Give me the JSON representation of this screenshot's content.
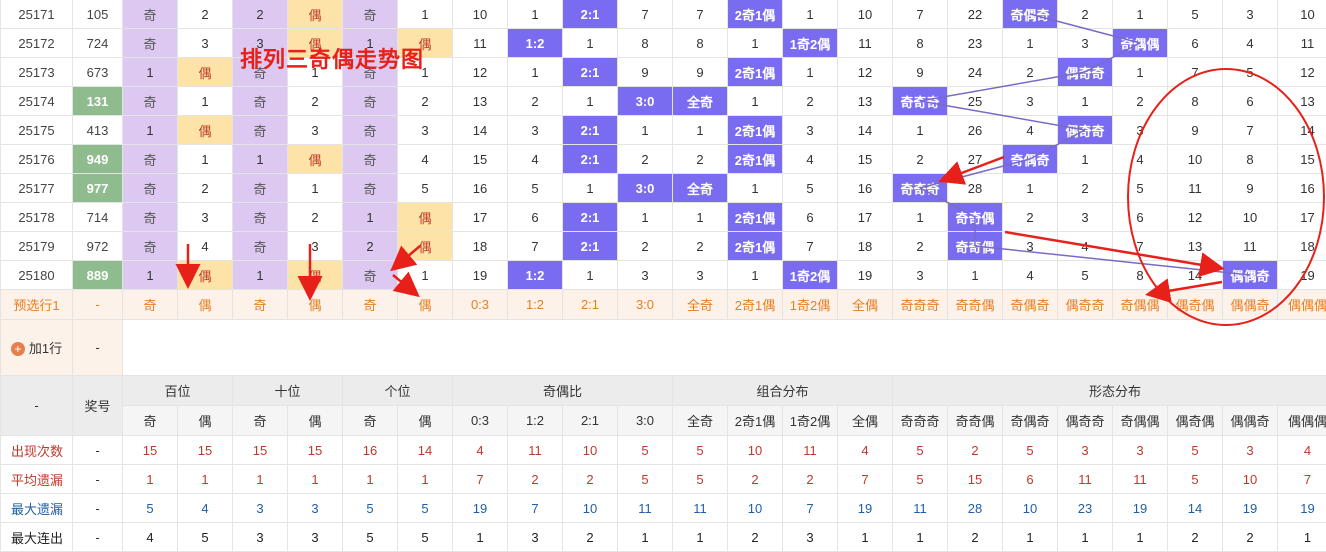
{
  "overlay_title": "排列三奇偶走势图",
  "rows": [
    {
      "issue": "25171",
      "num": "105",
      "big": false,
      "bai": [
        "奇",
        "2"
      ],
      "shi": [
        "2",
        "偶"
      ],
      "ge": [
        "奇",
        "1"
      ],
      "ratio": [
        "10",
        "1",
        "2:1",
        "7"
      ],
      "combo": [
        "7",
        "2奇1偶",
        "1",
        "10"
      ],
      "shape": [
        "7",
        "22",
        "奇偶奇",
        "2",
        "1",
        "5",
        "3",
        "10"
      ]
    },
    {
      "issue": "25172",
      "num": "724",
      "big": false,
      "bai": [
        "奇",
        "3"
      ],
      "shi": [
        "3",
        "偶"
      ],
      "ge": [
        "1",
        "偶"
      ],
      "ratio": [
        "11",
        "1:2",
        "1",
        "8"
      ],
      "combo": [
        "8",
        "1",
        "1奇2偶",
        "11"
      ],
      "shape": [
        "8",
        "23",
        "1",
        "3",
        "奇偶偶",
        "6",
        "4",
        "11"
      ]
    },
    {
      "issue": "25173",
      "num": "673",
      "big": false,
      "bai": [
        "1",
        "偶"
      ],
      "shi": [
        "奇",
        "1"
      ],
      "ge": [
        "奇",
        "1"
      ],
      "ratio": [
        "12",
        "1",
        "2:1",
        "9"
      ],
      "combo": [
        "9",
        "2奇1偶",
        "1",
        "12"
      ],
      "shape": [
        "9",
        "24",
        "2",
        "偶奇奇",
        "1",
        "7",
        "5",
        "12"
      ]
    },
    {
      "issue": "25174",
      "num": "131",
      "big": true,
      "bai": [
        "奇",
        "1"
      ],
      "shi": [
        "奇",
        "2"
      ],
      "ge": [
        "奇",
        "2"
      ],
      "ratio": [
        "13",
        "2",
        "1",
        "3:0"
      ],
      "combo": [
        "全奇",
        "1",
        "2",
        "13"
      ],
      "shape": [
        "奇奇奇",
        "25",
        "3",
        "1",
        "2",
        "8",
        "6",
        "13"
      ]
    },
    {
      "issue": "25175",
      "num": "413",
      "big": false,
      "bai": [
        "1",
        "偶"
      ],
      "shi": [
        "奇",
        "3"
      ],
      "ge": [
        "奇",
        "3"
      ],
      "ratio": [
        "14",
        "3",
        "2:1",
        "1"
      ],
      "combo": [
        "1",
        "2奇1偶",
        "3",
        "14"
      ],
      "shape": [
        "1",
        "26",
        "4",
        "偶奇奇",
        "3",
        "9",
        "7",
        "14"
      ]
    },
    {
      "issue": "25176",
      "num": "949",
      "big": true,
      "bai": [
        "奇",
        "1"
      ],
      "shi": [
        "1",
        "偶"
      ],
      "ge": [
        "奇",
        "4"
      ],
      "ratio": [
        "15",
        "4",
        "2:1",
        "2"
      ],
      "combo": [
        "2",
        "2奇1偶",
        "4",
        "15"
      ],
      "shape": [
        "2",
        "27",
        "奇偶奇",
        "1",
        "4",
        "10",
        "8",
        "15"
      ]
    },
    {
      "issue": "25177",
      "num": "977",
      "big": true,
      "bai": [
        "奇",
        "2"
      ],
      "shi": [
        "奇",
        "1"
      ],
      "ge": [
        "奇",
        "5"
      ],
      "ratio": [
        "16",
        "5",
        "1",
        "3:0"
      ],
      "combo": [
        "全奇",
        "1",
        "5",
        "16"
      ],
      "shape": [
        "奇奇奇",
        "28",
        "1",
        "2",
        "5",
        "11",
        "9",
        "16"
      ]
    },
    {
      "issue": "25178",
      "num": "714",
      "big": false,
      "bai": [
        "奇",
        "3"
      ],
      "shi": [
        "奇",
        "2"
      ],
      "ge": [
        "1",
        "偶"
      ],
      "ratio": [
        "17",
        "6",
        "2:1",
        "1"
      ],
      "combo": [
        "1",
        "2奇1偶",
        "6",
        "17"
      ],
      "shape": [
        "1",
        "奇奇偶",
        "2",
        "3",
        "6",
        "12",
        "10",
        "17"
      ]
    },
    {
      "issue": "25179",
      "num": "972",
      "big": false,
      "bai": [
        "奇",
        "4"
      ],
      "shi": [
        "奇",
        "3"
      ],
      "ge": [
        "2",
        "偶"
      ],
      "ratio": [
        "18",
        "7",
        "2:1",
        "2"
      ],
      "combo": [
        "2",
        "2奇1偶",
        "7",
        "18"
      ],
      "shape": [
        "2",
        "奇奇偶",
        "3",
        "4",
        "7",
        "13",
        "11",
        "18"
      ]
    },
    {
      "issue": "25180",
      "num": "889",
      "big": true,
      "bai": [
        "1",
        "偶"
      ],
      "shi": [
        "1",
        "偶"
      ],
      "ge": [
        "奇",
        "1"
      ],
      "ratio": [
        "19",
        "1:2",
        "1",
        "3"
      ],
      "combo": [
        "3",
        "1",
        "1奇2偶",
        "19"
      ],
      "shape": [
        "3",
        "1",
        "4",
        "5",
        "8",
        "14",
        "偶偶奇",
        "19"
      ]
    }
  ],
  "predict": {
    "label": "预选行1",
    "dash": "-",
    "cells": [
      "奇",
      "偶",
      "奇",
      "偶",
      "奇",
      "偶",
      "0:3",
      "1:2",
      "2:1",
      "3:0",
      "全奇",
      "2奇1偶",
      "1奇2偶",
      "全偶",
      "奇奇奇",
      "奇奇偶",
      "奇偶奇",
      "偶奇奇",
      "奇偶偶",
      "偶奇偶",
      "偶偶奇",
      "偶偶偶"
    ]
  },
  "add_row": {
    "label": "加1行",
    "dash": "-",
    "plus": "+"
  },
  "header": {
    "dash": "-",
    "prize": "奖号",
    "groups": [
      "百位",
      "十位",
      "个位",
      "奇偶比",
      "组合分布",
      "形态分布"
    ],
    "sub": [
      "奇",
      "偶",
      "奇",
      "偶",
      "奇",
      "偶",
      "0:3",
      "1:2",
      "2:1",
      "3:0",
      "全奇",
      "2奇1偶",
      "1奇2偶",
      "全偶",
      "奇奇奇",
      "奇奇偶",
      "奇偶奇",
      "偶奇奇",
      "奇偶偶",
      "偶奇偶",
      "偶偶奇",
      "偶偶偶"
    ]
  },
  "stats": [
    {
      "label": "出现次数",
      "dash": "-",
      "values": [
        "15",
        "15",
        "15",
        "15",
        "16",
        "14",
        "4",
        "11",
        "10",
        "5",
        "5",
        "10",
        "11",
        "4",
        "5",
        "2",
        "5",
        "3",
        "3",
        "5",
        "3",
        "4"
      ]
    },
    {
      "label": "平均遗漏",
      "dash": "-",
      "values": [
        "1",
        "1",
        "1",
        "1",
        "1",
        "1",
        "7",
        "2",
        "2",
        "5",
        "5",
        "2",
        "2",
        "7",
        "5",
        "15",
        "6",
        "11",
        "11",
        "5",
        "10",
        "7"
      ]
    },
    {
      "label": "最大遗漏",
      "dash": "-",
      "values": [
        "5",
        "4",
        "3",
        "3",
        "5",
        "5",
        "19",
        "7",
        "10",
        "11",
        "11",
        "10",
        "7",
        "19",
        "11",
        "28",
        "10",
        "23",
        "19",
        "14",
        "19",
        "19"
      ]
    },
    {
      "label": "最大连出",
      "dash": "-",
      "values": [
        "4",
        "5",
        "3",
        "3",
        "5",
        "5",
        "1",
        "3",
        "2",
        "1",
        "1",
        "2",
        "3",
        "1",
        "1",
        "2",
        "1",
        "1",
        "1",
        "2",
        "2",
        "1"
      ]
    }
  ],
  "colors": {
    "purple_hit": "#7a6cf0",
    "lavender": "#dcc8f0",
    "yellow": "#fde3a7",
    "green": "#8fbc8f",
    "annotation_red": "#e8201a"
  }
}
